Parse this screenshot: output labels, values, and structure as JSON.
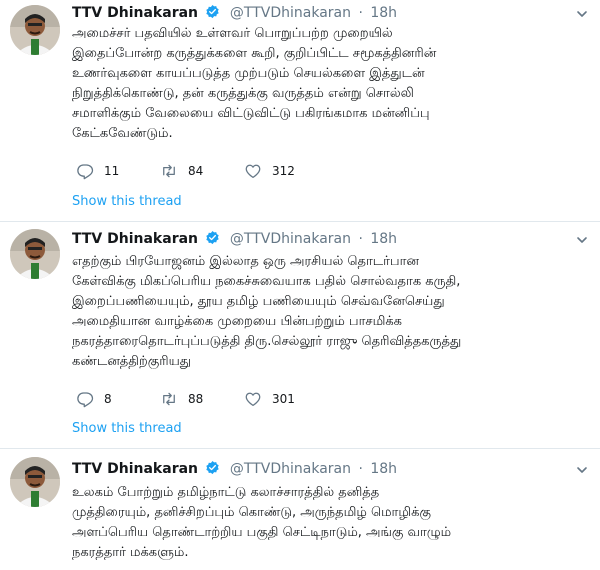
{
  "tweets": [
    {
      "author": "TTV Dhinakaran",
      "handle": "@TTVDhinakaran",
      "time": "18h",
      "lines": [
        "அமைச்சர் பதவியில் உள்ளவர் பொறுப்பற்ற முறையில்",
        "இதைப்போன்ற கருத்துக்களை கூறி, குறிப்பிட்ட சமூகத்தினரின்",
        "உணர்வுகளை காயப்படுத்த முற்படும் செயல்களை இத்துடன்",
        "நிறுத்திக்கொண்டு, தன் கருத்துக்கு வருத்தம் என்று சொல்லி",
        "சமாளிக்கும் வேலையை விட்டுவிட்டு பகிரங்கமாக மன்னிப்பு",
        "கேட்கவேண்டும்."
      ],
      "replies": "11",
      "retweets": "84",
      "likes": "312",
      "thread_link": "Show this thread"
    },
    {
      "author": "TTV Dhinakaran",
      "handle": "@TTVDhinakaran",
      "time": "18h",
      "lines": [
        "எதற்கும் பிரயோஜனம் இல்லாத ஒரு அரசியல் தொடர்பான",
        "கேள்விக்கு மிகப்பெரிய நகைச்சுவையாக பதில் சொல்வதாக கருதி,",
        "இறைப்பணியையும், தூய தமிழ் பணியையும் செவ்வனேசெய்து",
        "அமைதியான வாழ்க்கை முறையை பின்பற்றும் பாசமிக்க",
        "நகரத்தாரைதொடர்புப்படுத்தி திரு.செல்லூர் ராஜு தெரிவித்தகருத்து",
        "கண்டனத்திற்குரியது"
      ],
      "replies": "8",
      "retweets": "88",
      "likes": "301",
      "thread_link": "Show this thread"
    },
    {
      "author": "TTV Dhinakaran",
      "handle": "@TTVDhinakaran",
      "time": "18h",
      "lines": [
        "உலகம் போற்றும் தமிழ்நாட்டு கலாச்சாரத்தில் தனித்த",
        "முத்திரையும், தனிச்சிறப்பும் கொண்டு, அருந்தமிழ் மொழிக்கு",
        "அளப்பெரிய தொண்டாற்றிய பகுதி செட்டிநாடும், அங்கு வாழும்",
        "நகரத்தார் மக்களும்."
      ]
    }
  ],
  "colors": {
    "link": "#1da1f2",
    "meta": "#657786",
    "text": "#14171a",
    "border": "#e1e8ed"
  },
  "icons": {
    "verified": "verified-badge-icon",
    "caret": "chevron-down-icon",
    "reply": "reply-icon",
    "retweet": "retweet-icon",
    "like": "heart-icon"
  }
}
